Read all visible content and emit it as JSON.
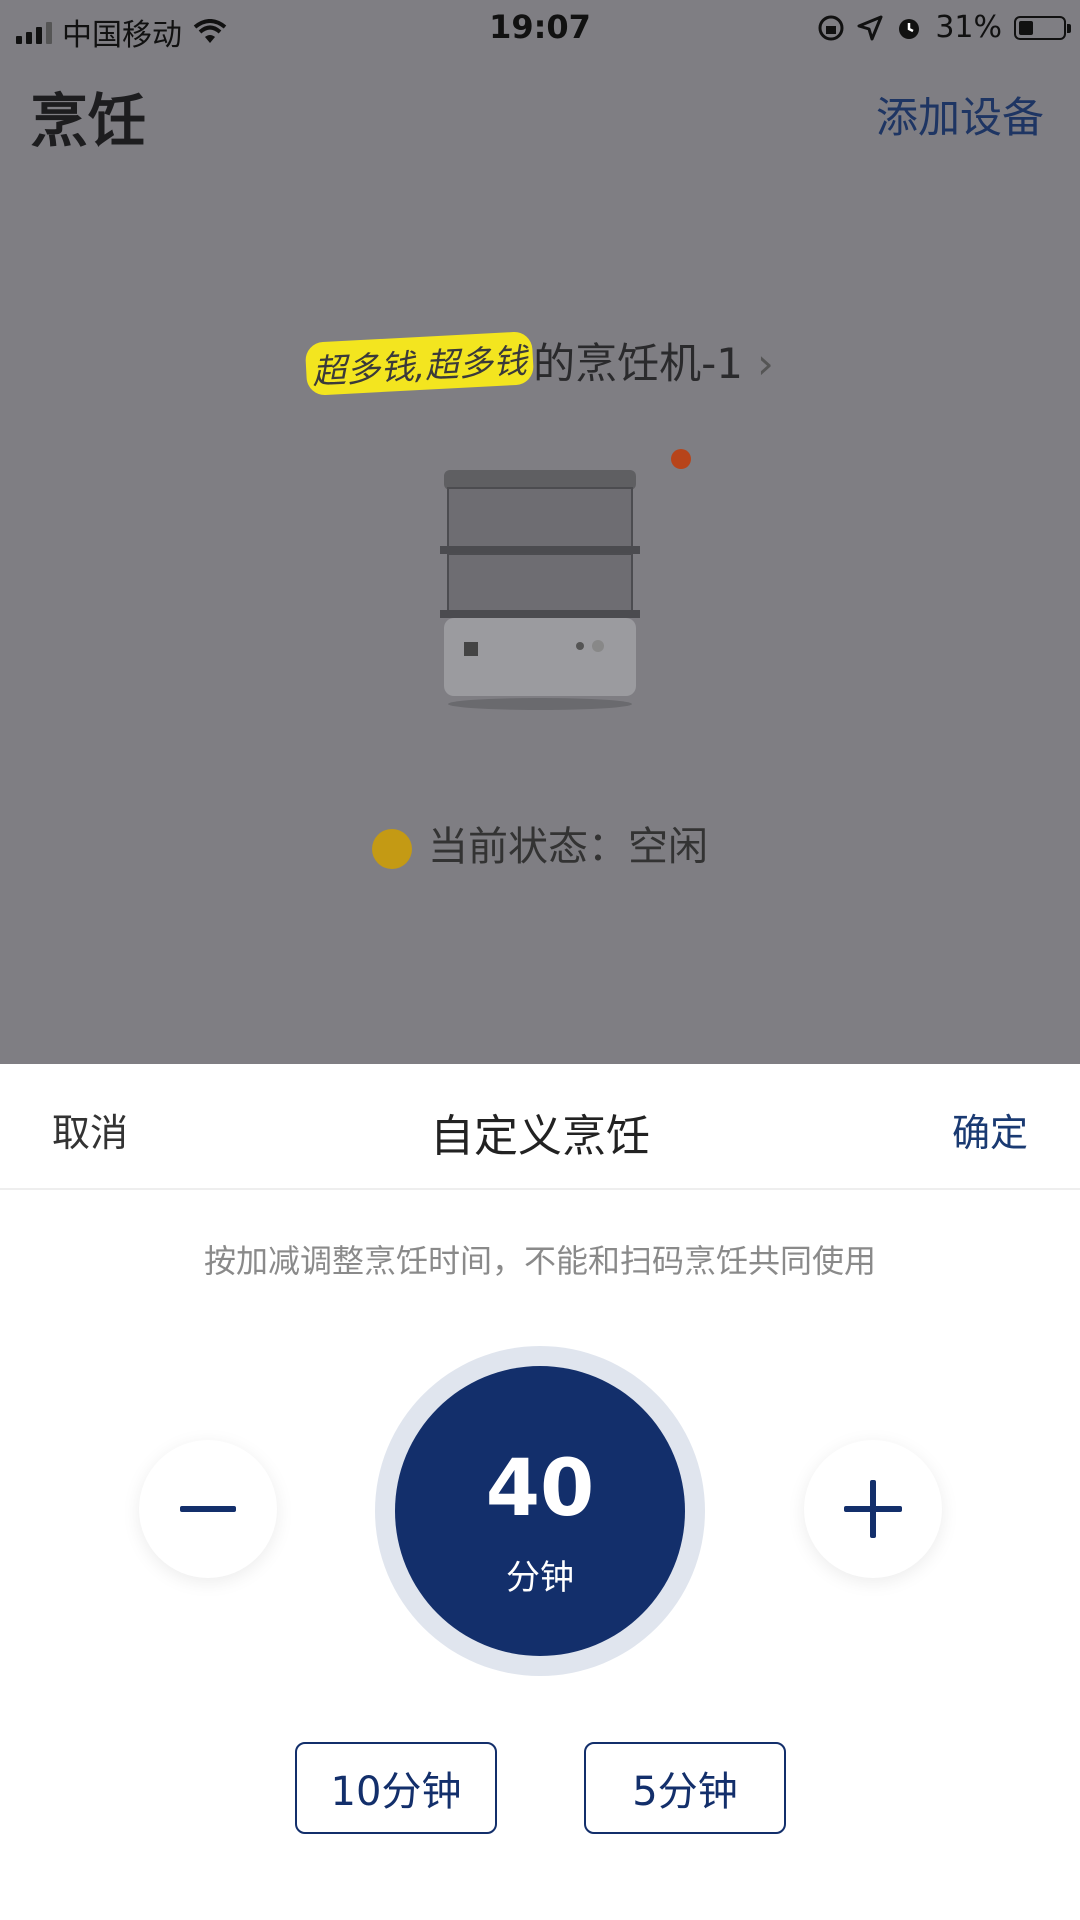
{
  "status_bar": {
    "carrier": "中国移动",
    "time": "19:07",
    "battery": "31%"
  },
  "header": {
    "title": "烹饪",
    "add_device": "添加设备"
  },
  "device": {
    "scribble_text": "超多钱,超多钱",
    "name_suffix": "的烹饪机-1",
    "chevron": "›",
    "status_label": "当前状态：",
    "status_value": "空闲"
  },
  "sheet": {
    "cancel": "取消",
    "title": "自定义烹饪",
    "confirm": "确定",
    "hint": "按加减调整烹饪时间，不能和扫码烹饪共同使用",
    "timer_value": "40",
    "timer_unit": "分钟",
    "presets": [
      "10分钟",
      "5分钟"
    ]
  },
  "colors": {
    "accent": "#132f6b",
    "status_idle": "#c49a14",
    "device_indicator": "#b7441a",
    "highlight": "#f3e51f"
  }
}
